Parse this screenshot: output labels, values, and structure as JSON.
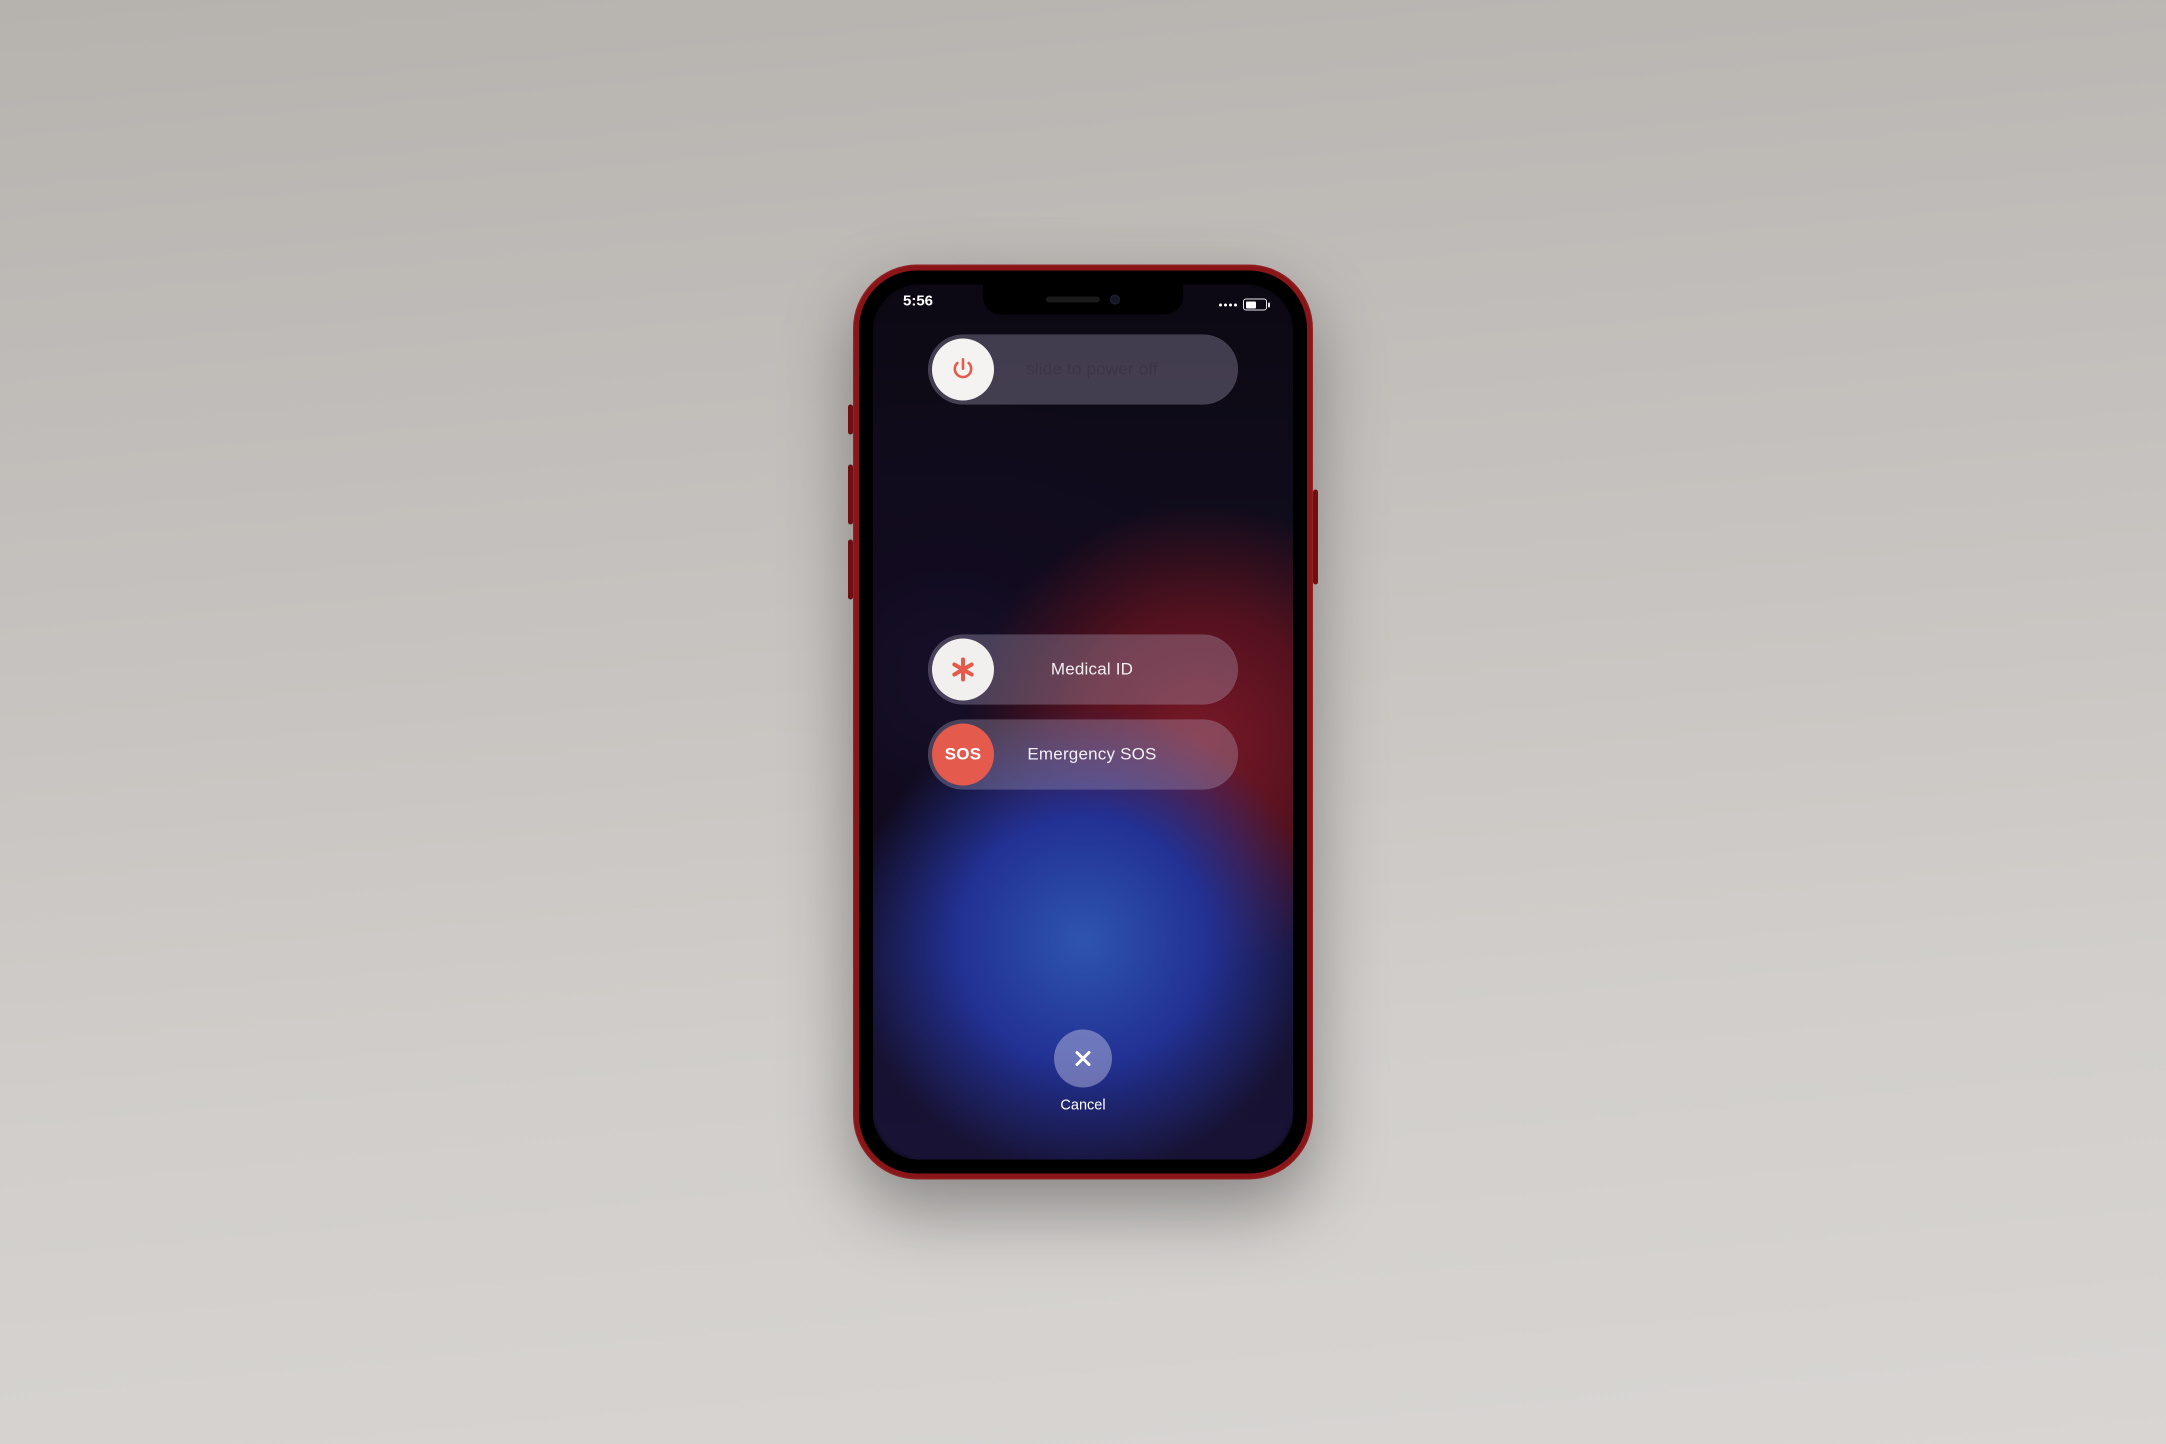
{
  "status": {
    "time": "5:56"
  },
  "sliders": {
    "power_off": {
      "label": "slide to power off"
    },
    "medical": {
      "label": "Medical ID"
    },
    "sos": {
      "label": "Emergency SOS",
      "knob_text": "SOS"
    }
  },
  "cancel": {
    "label": "Cancel"
  },
  "colors": {
    "phone_body": "#8a1518",
    "sos_knob": "#e45b4e",
    "power_icon": "#e45b4e",
    "medical_icon": "#e45b4e"
  }
}
